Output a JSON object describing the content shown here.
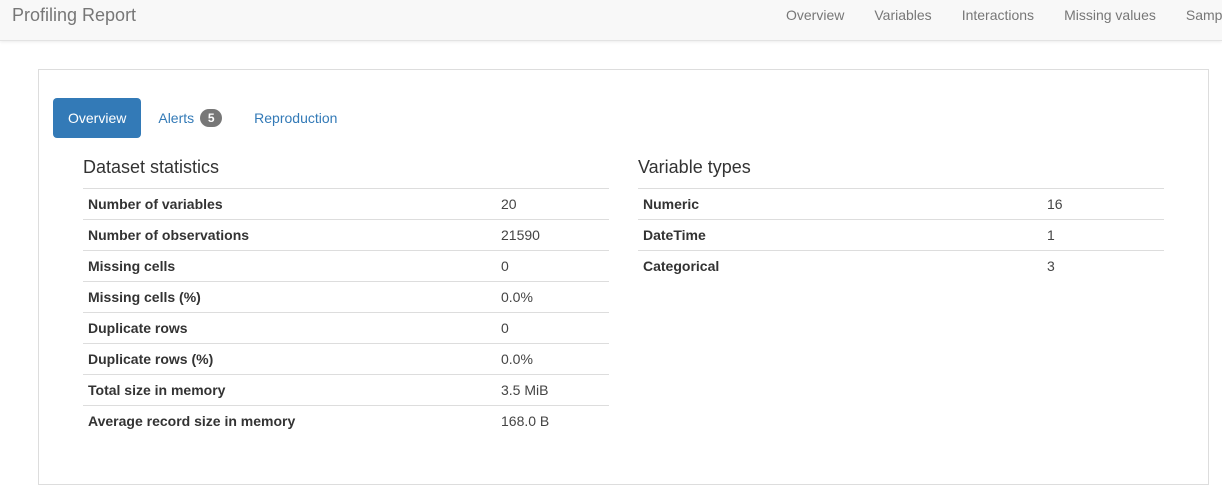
{
  "header": {
    "brand": "Profiling Report",
    "nav": [
      "Overview",
      "Variables",
      "Interactions",
      "Missing values",
      "Samp"
    ]
  },
  "tabs": {
    "overview": "Overview",
    "alerts": "Alerts",
    "alerts_count": "5",
    "reproduction": "Reproduction"
  },
  "dataset_statistics": {
    "title": "Dataset statistics",
    "rows": [
      {
        "label": "Number of variables",
        "value": "20"
      },
      {
        "label": "Number of observations",
        "value": "21590"
      },
      {
        "label": "Missing cells",
        "value": "0"
      },
      {
        "label": "Missing cells (%)",
        "value": "0.0%"
      },
      {
        "label": "Duplicate rows",
        "value": "0"
      },
      {
        "label": "Duplicate rows (%)",
        "value": "0.0%"
      },
      {
        "label": "Total size in memory",
        "value": "3.5 MiB"
      },
      {
        "label": "Average record size in memory",
        "value": "168.0 B"
      }
    ]
  },
  "variable_types": {
    "title": "Variable types",
    "rows": [
      {
        "label": "Numeric",
        "value": "16"
      },
      {
        "label": "DateTime",
        "value": "1"
      },
      {
        "label": "Categorical",
        "value": "3"
      }
    ]
  },
  "colors": {
    "accent": "#337ab7",
    "navbar_bg": "#f8f8f8",
    "badge_bg": "#777777"
  }
}
